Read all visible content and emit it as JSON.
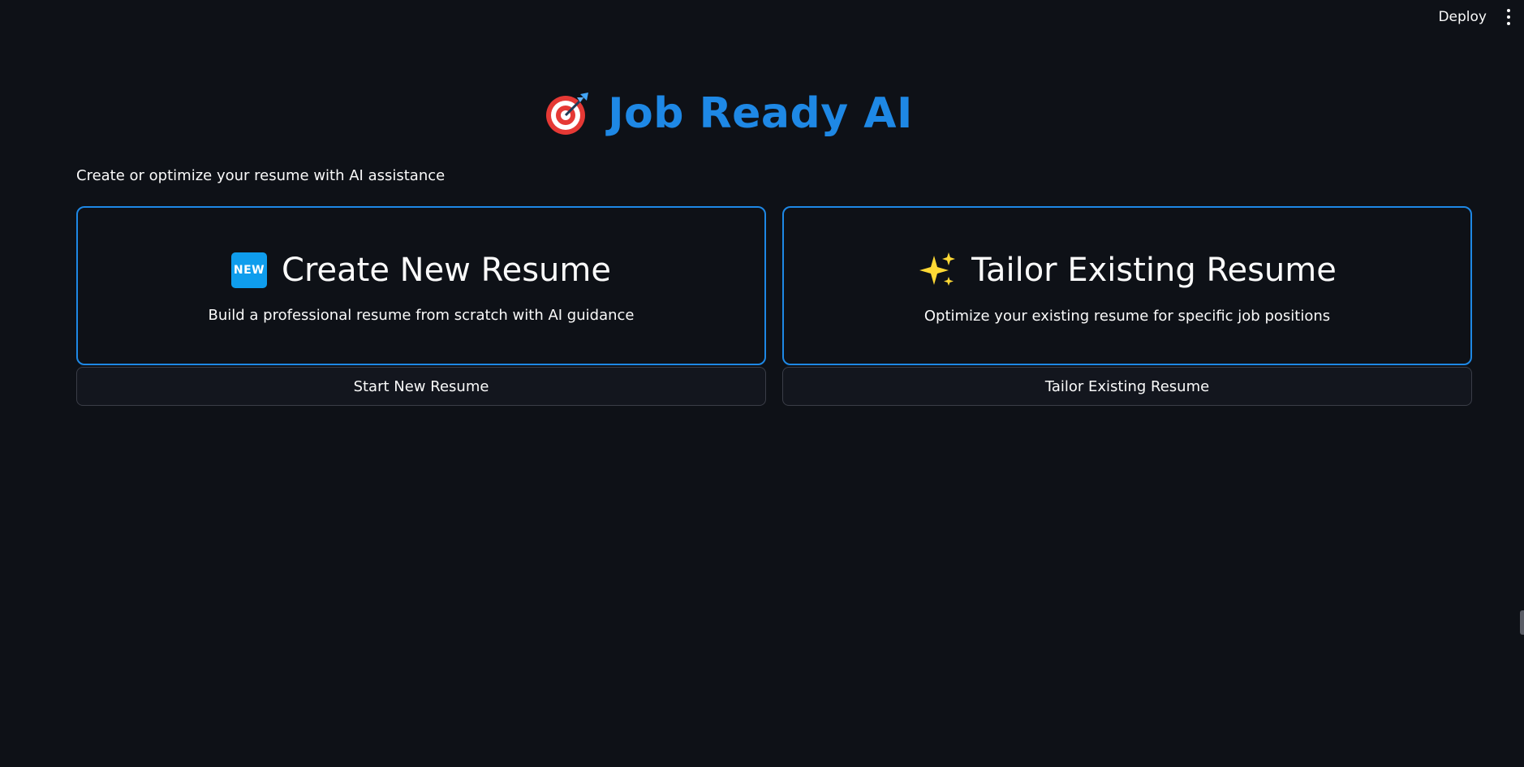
{
  "toolbar": {
    "deploy_label": "Deploy",
    "menu_icon": "vertical-ellipsis-icon"
  },
  "header": {
    "title": "Job Ready AI",
    "title_icon": "direct-hit-target-icon",
    "title_color": "#1e88e5"
  },
  "subtitle": "Create or optimize your resume with AI assistance",
  "cards": [
    {
      "icon": "new-button-icon",
      "icon_text": "NEW",
      "title": "Create New Resume",
      "description": "Build a professional resume from scratch with AI guidance",
      "button_label": "Start New Resume"
    },
    {
      "icon": "sparkles-icon",
      "title": "Tailor Existing Resume",
      "description": "Optimize your existing resume for specific job positions",
      "button_label": "Tailor Existing Resume"
    }
  ],
  "colors": {
    "background": "#0e1117",
    "accent": "#1e88e5",
    "text": "#fafafa"
  }
}
